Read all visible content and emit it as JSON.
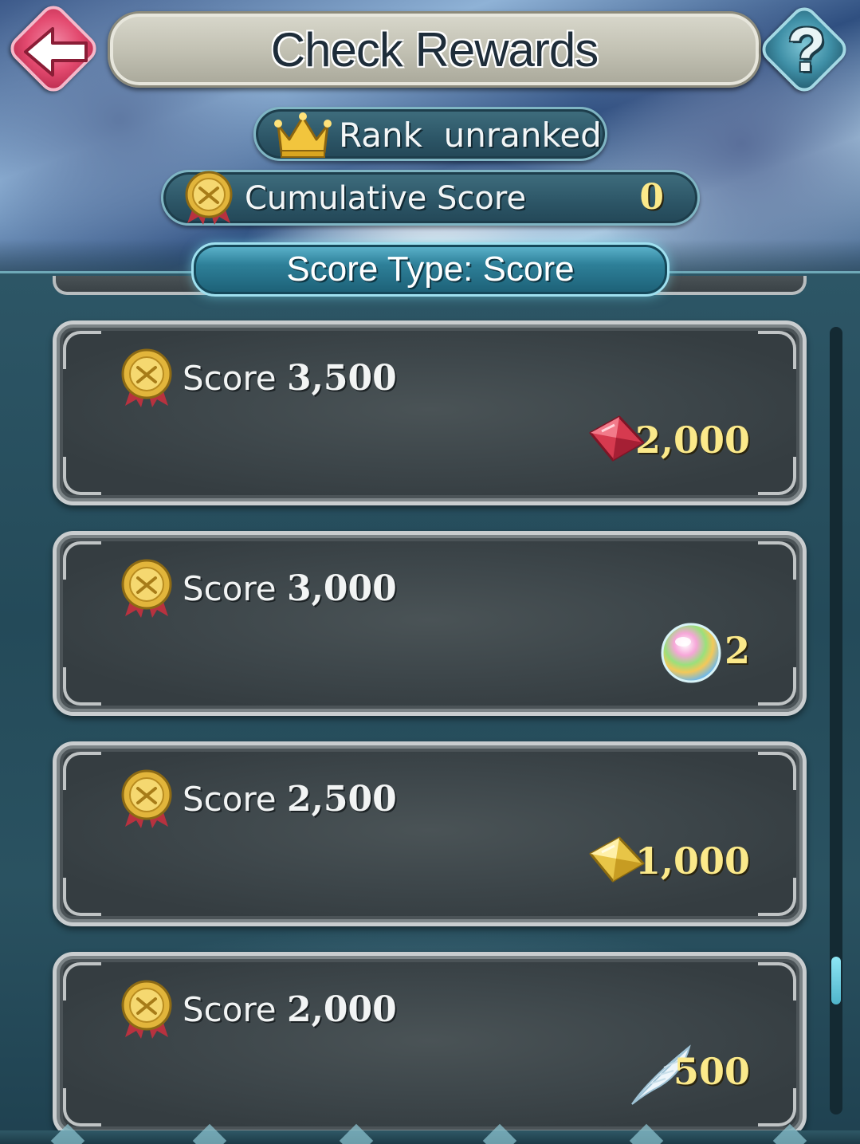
{
  "header": {
    "title": "Check Rewards",
    "help_label": "?"
  },
  "rank": {
    "label": "Rank  unranked"
  },
  "cumulative": {
    "label": "Cumulative Score",
    "value": "0"
  },
  "score_type": {
    "label": "Score Type: Score"
  },
  "rewards": [
    {
      "score_prefix": "Score ",
      "score_value": "3,500",
      "reward_icon": "red-orb-crystal-icon",
      "amount": "2,000"
    },
    {
      "score_prefix": "Score ",
      "score_value": "3,000",
      "reward_icon": "rainbow-orb-icon",
      "amount": "2"
    },
    {
      "score_prefix": "Score ",
      "score_value": "2,500",
      "reward_icon": "gold-crystal-icon",
      "amount": "1,000"
    },
    {
      "score_prefix": "Score ",
      "score_value": "2,000",
      "reward_icon": "white-feather-icon",
      "amount": "500"
    }
  ],
  "colors": {
    "accent_gold": "#fbe98a",
    "back_button": "#e34a6f",
    "help_button": "#3f8fa6",
    "tab_active": "#2e8099"
  },
  "scroll": {
    "position_fraction": 0.8
  }
}
